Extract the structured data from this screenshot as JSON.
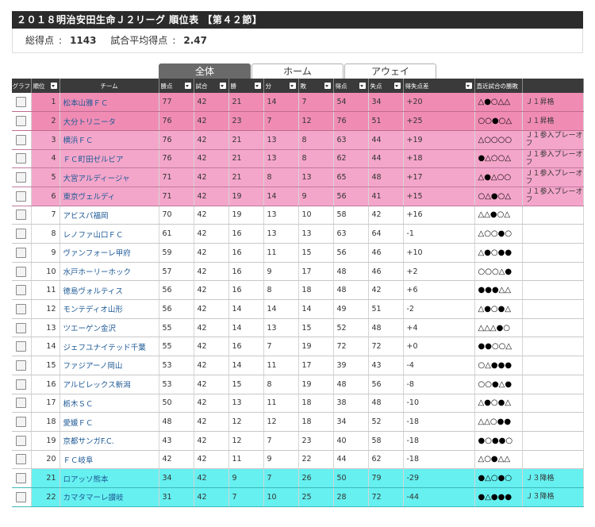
{
  "page": {
    "title": "２０１８明治安田生命Ｊ２リーグ 順位表 【第４２節】",
    "summary": {
      "total_goals_label": "総得点",
      "total_goals": "1143",
      "avg_goals_label": "試合平均得点",
      "avg_goals": "2.47"
    }
  },
  "tabs": [
    "全体",
    "ホーム",
    "アウェイ"
  ],
  "columns": [
    "グラフ",
    "順位",
    "チーム",
    "勝点",
    "試合",
    "勝",
    "分",
    "敗",
    "得点",
    "失点",
    "得失点差",
    "直近試合の勝敗",
    ""
  ],
  "rows": [
    {
      "rank": "1",
      "team": "松本山雅ＦＣ",
      "pts": "77",
      "gp": "42",
      "w": "21",
      "d": "14",
      "l": "7",
      "gf": "54",
      "ga": "34",
      "gd": "+20",
      "recent": "△●○△△",
      "note": "Ｊ１昇格",
      "zone": "promo"
    },
    {
      "rank": "2",
      "team": "大分トリニータ",
      "pts": "76",
      "gp": "42",
      "w": "23",
      "d": "7",
      "l": "12",
      "gf": "76",
      "ga": "51",
      "gd": "+25",
      "recent": "○○●○△",
      "note": "Ｊ１昇格",
      "zone": "promo"
    },
    {
      "rank": "3",
      "team": "横浜ＦＣ",
      "pts": "76",
      "gp": "42",
      "w": "21",
      "d": "13",
      "l": "8",
      "gf": "63",
      "ga": "44",
      "gd": "+19",
      "recent": "△○○○○",
      "note": "Ｊ１参入プレーオフ",
      "zone": "playoff"
    },
    {
      "rank": "4",
      "team": "ＦＣ町田ゼルビア",
      "pts": "76",
      "gp": "42",
      "w": "21",
      "d": "13",
      "l": "8",
      "gf": "62",
      "ga": "44",
      "gd": "+18",
      "recent": "●△○○△",
      "note": "Ｊ１参入プレーオフ",
      "zone": "playoff"
    },
    {
      "rank": "5",
      "team": "大宮アルディージャ",
      "pts": "71",
      "gp": "42",
      "w": "21",
      "d": "8",
      "l": "13",
      "gf": "65",
      "ga": "48",
      "gd": "+17",
      "recent": "△●△○○",
      "note": "Ｊ１参入プレーオフ",
      "zone": "playoff"
    },
    {
      "rank": "6",
      "team": "東京ヴェルディ",
      "pts": "71",
      "gp": "42",
      "w": "19",
      "d": "14",
      "l": "9",
      "gf": "56",
      "ga": "41",
      "gd": "+15",
      "recent": "○△●○△",
      "note": "Ｊ１参入プレーオフ",
      "zone": "playoff"
    },
    {
      "rank": "7",
      "team": "アビスパ福岡",
      "pts": "70",
      "gp": "42",
      "w": "19",
      "d": "13",
      "l": "10",
      "gf": "58",
      "ga": "42",
      "gd": "+16",
      "recent": "△△●○△",
      "note": "",
      "zone": "normal"
    },
    {
      "rank": "8",
      "team": "レノファ山口ＦＣ",
      "pts": "61",
      "gp": "42",
      "w": "16",
      "d": "13",
      "l": "13",
      "gf": "63",
      "ga": "64",
      "gd": "-1",
      "recent": "△○○●○",
      "note": "",
      "zone": "normal"
    },
    {
      "rank": "9",
      "team": "ヴァンフォーレ甲府",
      "pts": "59",
      "gp": "42",
      "w": "16",
      "d": "11",
      "l": "15",
      "gf": "56",
      "ga": "46",
      "gd": "+10",
      "recent": "△●○●●",
      "note": "",
      "zone": "normal"
    },
    {
      "rank": "10",
      "team": "水戸ホーリーホック",
      "pts": "57",
      "gp": "42",
      "w": "16",
      "d": "9",
      "l": "17",
      "gf": "48",
      "ga": "46",
      "gd": "+2",
      "recent": "○○○△●",
      "note": "",
      "zone": "normal"
    },
    {
      "rank": "11",
      "team": "徳島ヴォルティス",
      "pts": "56",
      "gp": "42",
      "w": "16",
      "d": "8",
      "l": "18",
      "gf": "48",
      "ga": "42",
      "gd": "+6",
      "recent": "●●●△△",
      "note": "",
      "zone": "normal"
    },
    {
      "rank": "12",
      "team": "モンテディオ山形",
      "pts": "56",
      "gp": "42",
      "w": "14",
      "d": "14",
      "l": "14",
      "gf": "49",
      "ga": "51",
      "gd": "-2",
      "recent": "△●○●△",
      "note": "",
      "zone": "normal"
    },
    {
      "rank": "13",
      "team": "ツエーゲン金沢",
      "pts": "55",
      "gp": "42",
      "w": "14",
      "d": "13",
      "l": "15",
      "gf": "52",
      "ga": "48",
      "gd": "+4",
      "recent": "△△△●○",
      "note": "",
      "zone": "normal"
    },
    {
      "rank": "14",
      "team": "ジェフユナイテッド千葉",
      "pts": "55",
      "gp": "42",
      "w": "16",
      "d": "7",
      "l": "19",
      "gf": "72",
      "ga": "72",
      "gd": "+0",
      "recent": "●●○○△",
      "note": "",
      "zone": "normal"
    },
    {
      "rank": "15",
      "team": "ファジアーノ岡山",
      "pts": "53",
      "gp": "42",
      "w": "14",
      "d": "11",
      "l": "17",
      "gf": "39",
      "ga": "43",
      "gd": "-4",
      "recent": "○△●●●",
      "note": "",
      "zone": "normal"
    },
    {
      "rank": "16",
      "team": "アルビレックス新潟",
      "pts": "53",
      "gp": "42",
      "w": "15",
      "d": "8",
      "l": "19",
      "gf": "48",
      "ga": "56",
      "gd": "-8",
      "recent": "○○●△●",
      "note": "",
      "zone": "normal"
    },
    {
      "rank": "17",
      "team": "栃木ＳＣ",
      "pts": "50",
      "gp": "42",
      "w": "13",
      "d": "11",
      "l": "18",
      "gf": "38",
      "ga": "48",
      "gd": "-10",
      "recent": "△●○●△",
      "note": "",
      "zone": "normal"
    },
    {
      "rank": "18",
      "team": "愛媛ＦＣ",
      "pts": "48",
      "gp": "42",
      "w": "12",
      "d": "12",
      "l": "18",
      "gf": "34",
      "ga": "52",
      "gd": "-18",
      "recent": "△△○●●",
      "note": "",
      "zone": "normal"
    },
    {
      "rank": "19",
      "team": "京都サンガF.C.",
      "pts": "43",
      "gp": "42",
      "w": "12",
      "d": "7",
      "l": "23",
      "gf": "40",
      "ga": "58",
      "gd": "-18",
      "recent": "●○●●○",
      "note": "",
      "zone": "normal"
    },
    {
      "rank": "20",
      "team": "ＦＣ岐阜",
      "pts": "42",
      "gp": "42",
      "w": "11",
      "d": "9",
      "l": "22",
      "gf": "44",
      "ga": "62",
      "gd": "-18",
      "recent": "△○●△△",
      "note": "",
      "zone": "normal"
    },
    {
      "rank": "21",
      "team": "ロアッソ熊本",
      "pts": "34",
      "gp": "42",
      "w": "9",
      "d": "7",
      "l": "26",
      "gf": "50",
      "ga": "79",
      "gd": "-29",
      "recent": "●△○●○",
      "note": "Ｊ３降格",
      "zone": "releg"
    },
    {
      "rank": "22",
      "team": "カマタマーレ讃岐",
      "pts": "31",
      "gp": "42",
      "w": "7",
      "d": "10",
      "l": "25",
      "gf": "28",
      "ga": "72",
      "gd": "-44",
      "recent": "●△●●●",
      "note": "Ｊ３降格",
      "zone": "releg"
    }
  ]
}
